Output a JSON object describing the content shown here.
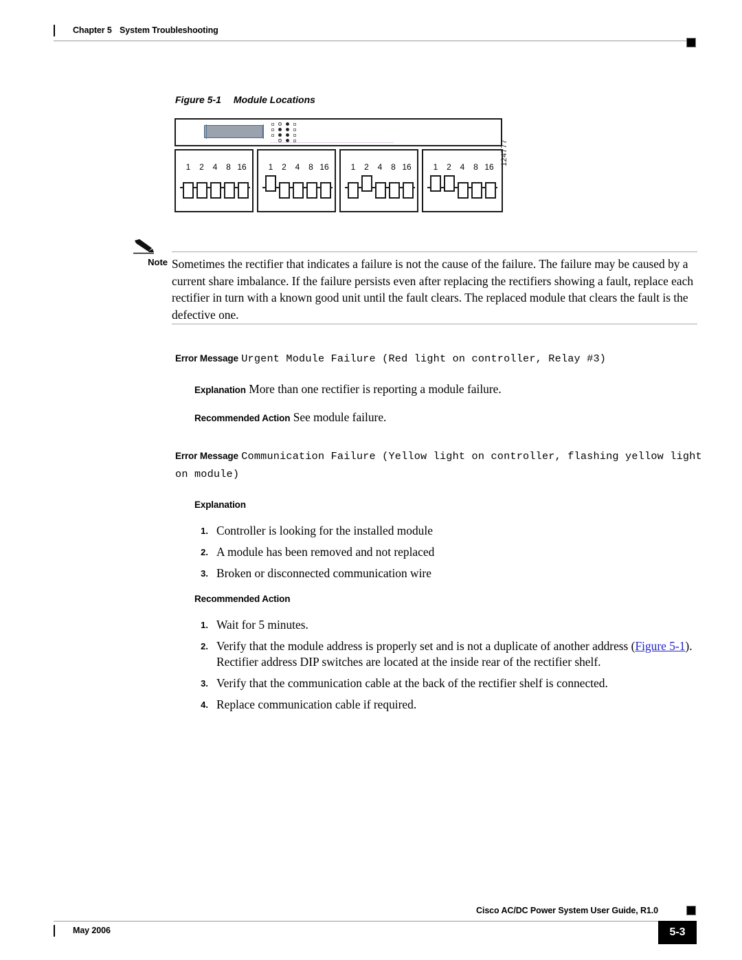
{
  "header": {
    "chapter": "Chapter 5",
    "title": "System Troubleshooting"
  },
  "figure": {
    "number": "Figure 5-1",
    "title": "Module Locations",
    "graphic_id": "124777",
    "dip_labels": [
      "1",
      "2",
      "4",
      "8",
      "16"
    ],
    "panels": [
      {
        "name": "module-address-0",
        "switch_states": [
          "down",
          "down",
          "down",
          "down",
          "down"
        ]
      },
      {
        "name": "module-address-1",
        "switch_states": [
          "up",
          "down",
          "down",
          "down",
          "down"
        ]
      },
      {
        "name": "module-address-2",
        "switch_states": [
          "down",
          "up",
          "down",
          "down",
          "down"
        ]
      },
      {
        "name": "module-address-3",
        "switch_states": [
          "up",
          "up",
          "down",
          "down",
          "down"
        ]
      }
    ],
    "controller_leds": [
      [
        "off",
        "on"
      ],
      [
        "on",
        "on"
      ],
      [
        "on",
        "on"
      ],
      [
        "off",
        "on"
      ]
    ]
  },
  "note": {
    "label": "Note",
    "text": "Sometimes the rectifier that indicates a failure is not the cause of the failure. The failure may be caused by a current share imbalance. If the failure persists even after replacing the rectifiers showing a fault, replace each rectifier in turn with a known good unit until the fault clears. The replaced module that clears the fault is the defective one."
  },
  "messages": [
    {
      "error_label": "Error Message",
      "error_text": "Urgent Module Failure (Red light on controller, Relay #3)",
      "explanation_label": "Explanation",
      "explanation_text": "More than one rectifier is reporting a module failure.",
      "action_label": "Recommended Action",
      "action_text": "See module failure."
    },
    {
      "error_label": "Error Message",
      "error_text": "Communication Failure (Yellow light on controller, flashing yellow light on module)",
      "explanation_label": "Explanation",
      "explanation_items": [
        {
          "num": "1.",
          "text": "Controller is looking for the installed module"
        },
        {
          "num": "2.",
          "text": "A module has been removed and not replaced"
        },
        {
          "num": "3.",
          "text": "Broken or disconnected communication wire"
        }
      ],
      "action_label": "Recommended Action",
      "action_items": [
        {
          "num": "1.",
          "text": "Wait for 5 minutes."
        },
        {
          "num": "2.",
          "prefix": "Verify that the module address is properly set and is not a duplicate of another address (",
          "link": "Figure 5-1",
          "suffix": "). Rectifier address DIP switches are located at the inside rear of the rectifier shelf."
        },
        {
          "num": "3.",
          "text": "Verify that the communication cable at the back of the rectifier shelf is connected."
        },
        {
          "num": "4.",
          "text": "Replace communication cable if required."
        }
      ]
    }
  ],
  "footer": {
    "guide": "Cisco AC/DC Power System User Guide, R1.0",
    "date": "May 2006",
    "page_number": "5-3"
  },
  "colors": {
    "link": "#2222cc",
    "rule": "#9a9a9a",
    "lcd": "#9aa2ae"
  }
}
